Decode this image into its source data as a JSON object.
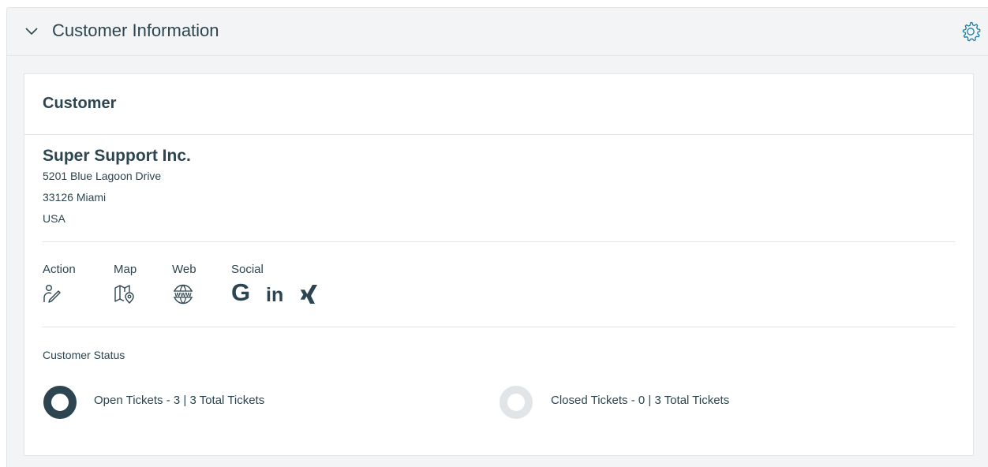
{
  "widget": {
    "title": "Customer Information"
  },
  "card": {
    "title": "Customer",
    "organization": {
      "name": "Super Support Inc.",
      "address": [
        "5201 Blue Lagoon Drive",
        "33126 Miami",
        "USA"
      ]
    },
    "groups": {
      "action": "Action",
      "map": "Map",
      "web": "Web",
      "social": "Social"
    },
    "social_links": {
      "google": "G",
      "linkedin": "in"
    },
    "icons": {
      "chevron": "chevron-down-icon",
      "settings": "gear-icon",
      "action": "user-edit-icon",
      "map": "map-pin-icon",
      "web": "www-globe-icon",
      "xing": "xing-icon"
    },
    "status": {
      "heading": "Customer Status",
      "open": {
        "label": "Open Tickets - 3 | 3 Total Tickets",
        "fraction": 1.0
      },
      "closed": {
        "label": "Closed Tickets - 0 | 3 Total Tickets",
        "fraction": 0.0
      }
    }
  },
  "colors": {
    "primary": "#2d4550",
    "accent": "#1d7ca0",
    "divider": "#e2e5e7",
    "donut_empty": "#e2e5e7"
  }
}
